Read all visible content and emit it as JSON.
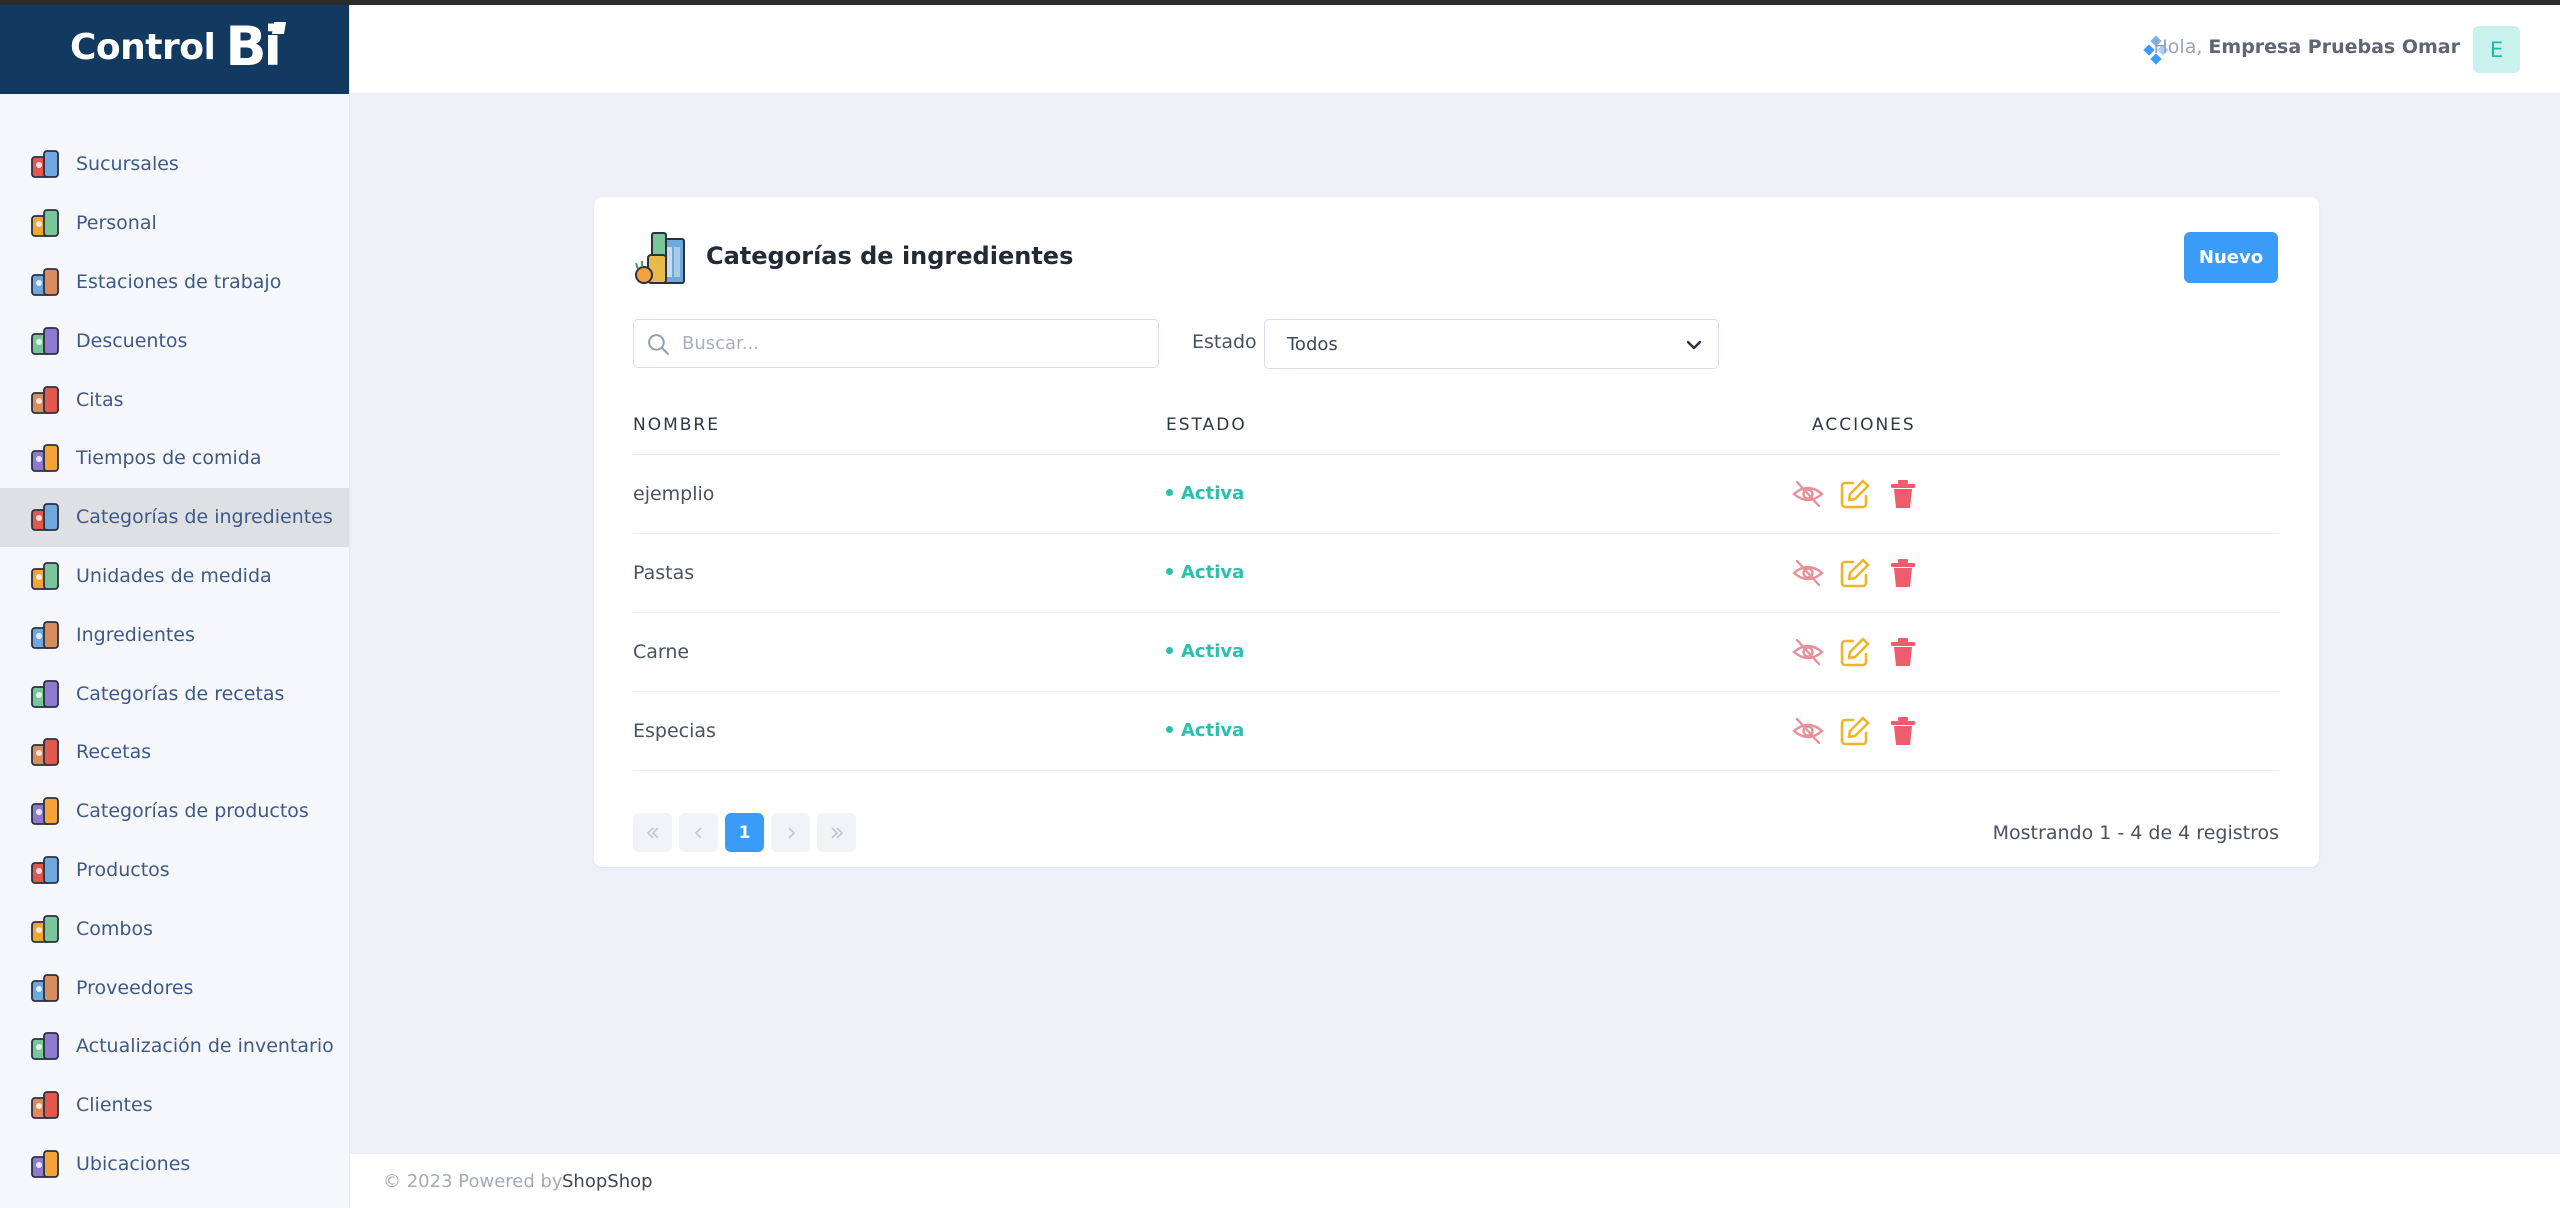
{
  "brand": {
    "text": "Control",
    "accent": "Bi"
  },
  "sidebar": {
    "items": [
      {
        "label": "Sucursales",
        "icon": "store-icon"
      },
      {
        "label": "Personal",
        "icon": "people-icon"
      },
      {
        "label": "Estaciones de trabajo",
        "icon": "workstation-icon"
      },
      {
        "label": "Descuentos",
        "icon": "discount-icon"
      },
      {
        "label": "Citas",
        "icon": "calendar-icon"
      },
      {
        "label": "Tiempos de comida",
        "icon": "meal-time-icon"
      },
      {
        "label": "Categorías de ingredientes",
        "icon": "ingredients-category-icon"
      },
      {
        "label": "Unidades de medida",
        "icon": "measure-icon"
      },
      {
        "label": "Ingredientes",
        "icon": "ingredients-icon"
      },
      {
        "label": "Categorías de recetas",
        "icon": "recipe-book-icon"
      },
      {
        "label": "Recetas",
        "icon": "recipe-icon"
      },
      {
        "label": "Categorías de productos",
        "icon": "products-category-icon"
      },
      {
        "label": "Productos",
        "icon": "products-icon"
      },
      {
        "label": "Combos",
        "icon": "combo-icon"
      },
      {
        "label": "Proveedores",
        "icon": "supplier-icon"
      },
      {
        "label": "Actualización de inventario",
        "icon": "inventory-icon"
      },
      {
        "label": "Clientes",
        "icon": "clients-icon"
      },
      {
        "label": "Ubicaciones",
        "icon": "location-icon"
      }
    ],
    "active_index": 6
  },
  "header": {
    "greeting": "Hola,",
    "user_name": "Empresa Pruebas Omar",
    "avatar_initial": "E"
  },
  "card": {
    "title": "Categorías de ingredientes",
    "new_button": "Nuevo",
    "search_placeholder": "Buscar...",
    "estado_label": "Estado",
    "estado_value": "Todos",
    "columns": [
      "NOMBRE",
      "ESTADO",
      "ACCIONES"
    ],
    "rows": [
      {
        "name": "ejemplio",
        "status": "Activa"
      },
      {
        "name": "Pastas",
        "status": "Activa"
      },
      {
        "name": "Carne",
        "status": "Activa"
      },
      {
        "name": "Especias",
        "status": "Activa"
      }
    ],
    "current_page": "1",
    "showing": "Mostrando 1 - 4 de 4 registros"
  },
  "footer": {
    "text": "© 2023 Powered by",
    "link": "ShopShop"
  },
  "colors": {
    "brand_bg": "#12395f",
    "primary": "#3b9cf7",
    "active_status": "#2bbfae",
    "edit": "#f0b429",
    "delete": "#ef5c6b",
    "hide": "#e8909a"
  }
}
